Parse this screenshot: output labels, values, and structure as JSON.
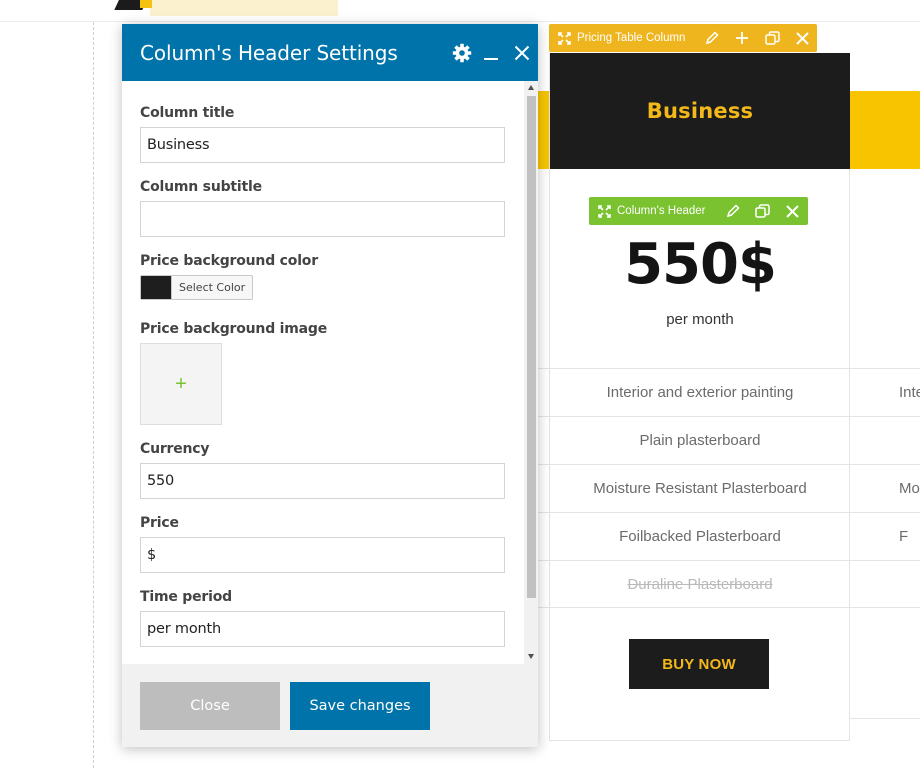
{
  "modal": {
    "title": "Column's Header Settings",
    "icons": [
      "gear-icon",
      "minimize-icon",
      "close-icon"
    ],
    "fields": {
      "column_title": {
        "label": "Column title",
        "value": "Business"
      },
      "column_subtitle": {
        "label": "Column subtitle",
        "value": ""
      },
      "price_bg_color": {
        "label": "Price background color",
        "button_label": "Select Color",
        "value": "#1e1e1e"
      },
      "price_bg_image": {
        "label": "Price background image",
        "add_symbol": "+"
      },
      "currency": {
        "label": "Currency",
        "value": "550"
      },
      "price": {
        "label": "Price",
        "value": "$"
      },
      "time_period": {
        "label": "Time period",
        "value": "per month"
      }
    },
    "footer": {
      "close_label": "Close",
      "save_label": "Save changes"
    }
  },
  "toolbars": {
    "pricing_column": {
      "label": "Pricing Table Column",
      "icons": [
        "move-icon",
        "pencil-icon",
        "plus-icon",
        "duplicate-icon",
        "close-icon"
      ],
      "color": "#efb51e"
    },
    "column_header": {
      "label": "Column's Header",
      "icons": [
        "move-icon",
        "pencil-icon",
        "duplicate-icon",
        "close-icon"
      ],
      "color": "#7ac230"
    }
  },
  "pricing_column": {
    "title": "Business",
    "price": "550$",
    "period": "per month",
    "features": [
      {
        "text": "Interior and exterior painting",
        "struck": false
      },
      {
        "text": "Plain plasterboard",
        "struck": false
      },
      {
        "text": "Moisture Resistant Plasterboard",
        "struck": false
      },
      {
        "text": "Foilbacked Plasterboard",
        "struck": false
      },
      {
        "text": "Duraline Plasterboard",
        "struck": true
      }
    ],
    "button_label": "BUY NOW",
    "header_bg": "#1c1c1c",
    "accent": "#f3b81a"
  },
  "adjacent_column": {
    "features_partial": [
      "Inte",
      "",
      "Mois",
      "F",
      ""
    ]
  },
  "colors": {
    "primary": "#0073aa",
    "toolbar_yellow": "#efb51e",
    "toolbar_green": "#7ac230",
    "accent_yellow": "#f8c400"
  }
}
